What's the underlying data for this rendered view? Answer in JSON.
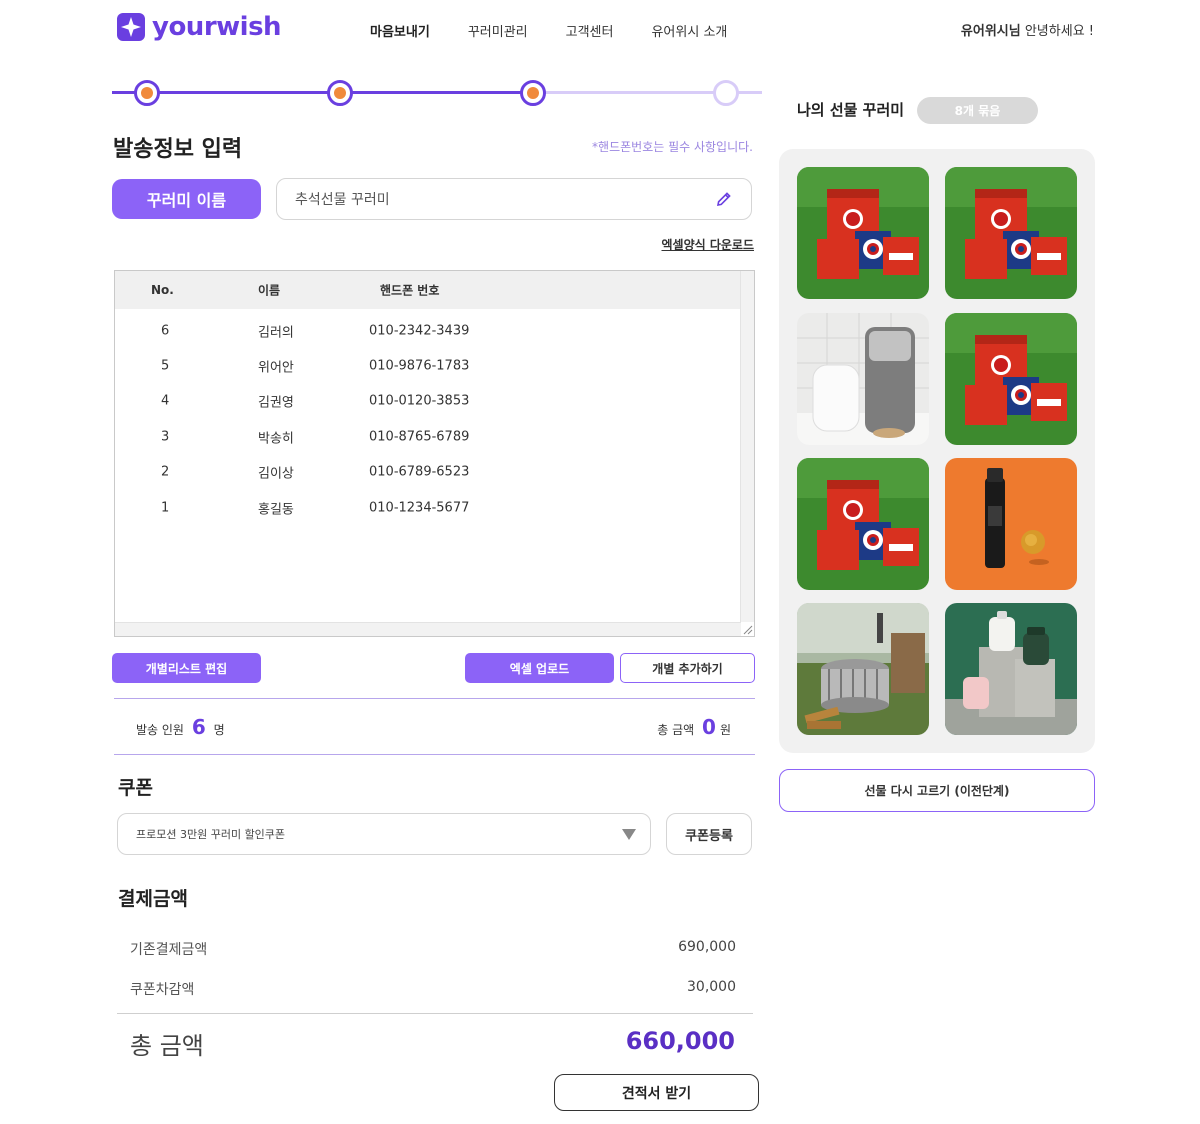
{
  "header": {
    "logo_text": "yourwish",
    "nav": [
      "마음보내기",
      "꾸러미관리",
      "고객센터",
      "유어위시 소개"
    ],
    "greeting_user": "유어위시님",
    "greeting_text": " 안녕하세요 !"
  },
  "stepper": {
    "current_step": 3,
    "total_steps": 4
  },
  "colors": {
    "accent": "#8c63f7",
    "brand": "#6a3fe0",
    "step_dot": "#f08a3c",
    "total": "#5a2fc4"
  },
  "form": {
    "title": "발송정보 입력",
    "required_note": "*핸드폰번호는 필수 사항입니다.",
    "name_label": "꾸러미 이름",
    "name_value": "추석선물 꾸러미",
    "excel_download": "엑셀양식 다운로드"
  },
  "table": {
    "headers": [
      "No.",
      "이름",
      "핸드폰 번호"
    ],
    "rows": [
      {
        "no": "6",
        "name": "김러의",
        "phone": "010-2342-3439"
      },
      {
        "no": "5",
        "name": "위어안",
        "phone": "010-9876-1783"
      },
      {
        "no": "4",
        "name": "김권영",
        "phone": "010-0120-3853"
      },
      {
        "no": "3",
        "name": "박송히",
        "phone": "010-8765-6789"
      },
      {
        "no": "2",
        "name": "김이상",
        "phone": "010-6789-6523"
      },
      {
        "no": "1",
        "name": "홍길동",
        "phone": "010-1234-5677"
      }
    ]
  },
  "actions": {
    "edit_list": "개별리스트 편집",
    "excel_upload": "엑셀 업로드",
    "add_individual": "개별 추가하기"
  },
  "summary": {
    "recipients_label": "발송 인원",
    "recipients_count": "6",
    "recipients_unit": "명",
    "total_label": "총 금액",
    "total_amount": "0",
    "total_unit": "원"
  },
  "coupon": {
    "title": "쿠폰",
    "selected": "프로모션 3만원 꾸러미 할인쿠폰",
    "register_button": "쿠폰등록"
  },
  "payment": {
    "title": "결제금액",
    "rows": [
      {
        "label": "기존결제금액",
        "value": "690,000"
      },
      {
        "label": "쿠폰차감액",
        "value": "30,000"
      }
    ],
    "total_label": "총 금액",
    "total_value": "660,000",
    "quote_button": "견적서 받기"
  },
  "gifts": {
    "title": "나의 선물 꾸러미",
    "bundle_count": "8개 묶음",
    "items": [
      {
        "icon": "marvel-cooler-set-image"
      },
      {
        "icon": "marvel-cooler-set-image"
      },
      {
        "icon": "white-appliance-image"
      },
      {
        "icon": "marvel-cooler-set-image"
      },
      {
        "icon": "marvel-cooler-set-image"
      },
      {
        "icon": "cosmetic-bottle-image"
      },
      {
        "icon": "fire-pit-image"
      },
      {
        "icon": "water-dispenser-image"
      }
    ],
    "reselect_button": "선물 다시 고르기 (이전단계)"
  }
}
